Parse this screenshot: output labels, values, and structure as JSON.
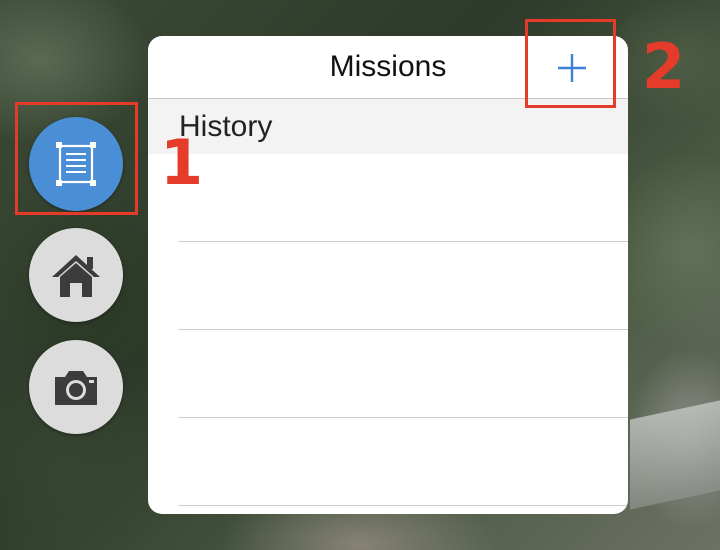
{
  "map": {
    "background": "satellite-map"
  },
  "left_buttons": [
    {
      "icon": "missions-list-icon",
      "color": "#4a8fd6",
      "active": true
    },
    {
      "icon": "home-icon",
      "color": "#dcdcdc",
      "active": false
    },
    {
      "icon": "camera-icon",
      "color": "#dcdcdc",
      "active": false
    }
  ],
  "panel": {
    "title": "Missions",
    "add_button_icon": "plus-icon",
    "accent_color": "#3b82d6",
    "section_title": "History",
    "rows": [
      "",
      "",
      "",
      ""
    ]
  },
  "annotations": {
    "label_1": "1",
    "label_2": "2",
    "color": "#e53b2b"
  }
}
